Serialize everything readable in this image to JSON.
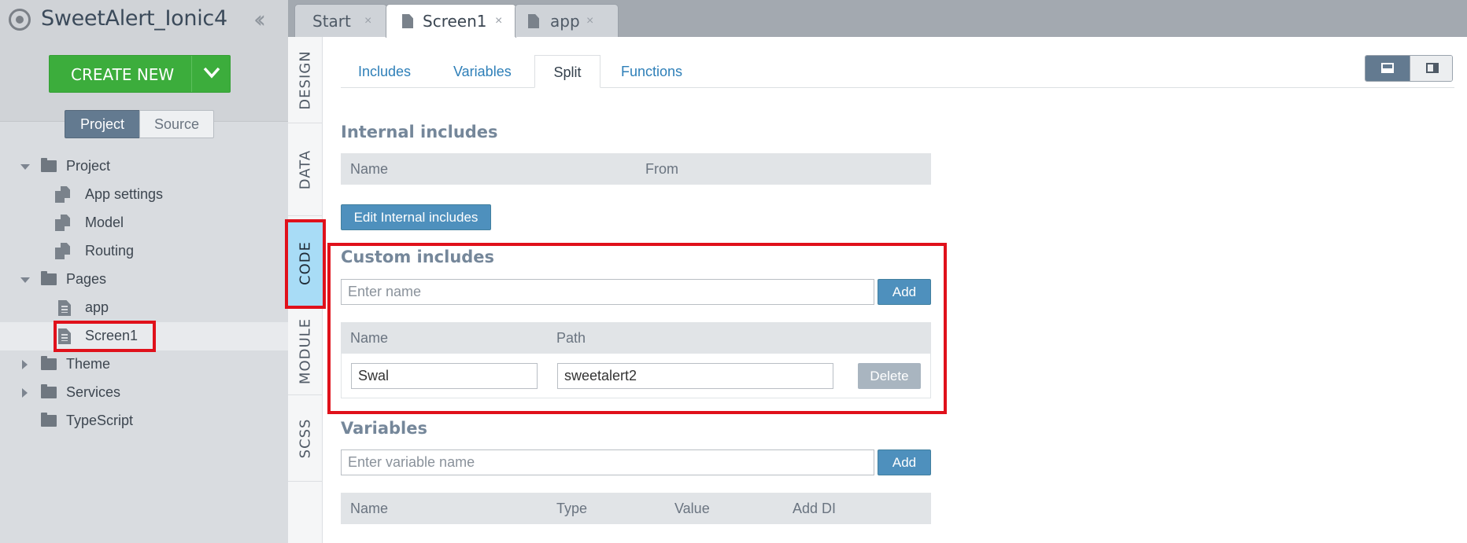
{
  "app": {
    "title": "SweetAlert_Ionic4",
    "create_label": "CREATE NEW"
  },
  "sidebar": {
    "segments": [
      {
        "label": "Project"
      },
      {
        "label": "Source"
      }
    ],
    "tree": {
      "project": "Project",
      "app_settings": "App settings",
      "model": "Model",
      "routing": "Routing",
      "pages": "Pages",
      "app": "app",
      "screen1": "Screen1",
      "theme": "Theme",
      "services": "Services",
      "typescript": "TypeScript"
    }
  },
  "tabs": [
    {
      "label": "Start",
      "close": "×"
    },
    {
      "label": "Screen1",
      "close": "×"
    },
    {
      "label": "app",
      "close": "×"
    }
  ],
  "vtabs": [
    {
      "label": "DESIGN"
    },
    {
      "label": "DATA"
    },
    {
      "label": "CODE"
    },
    {
      "label": "MODULE"
    },
    {
      "label": "SCSS"
    }
  ],
  "subtabs": [
    {
      "label": "Includes"
    },
    {
      "label": "Variables"
    },
    {
      "label": "Split"
    },
    {
      "label": "Functions"
    }
  ],
  "internal": {
    "title": "Internal includes",
    "col_name": "Name",
    "col_from": "From",
    "edit_label": "Edit Internal includes"
  },
  "custom": {
    "title": "Custom includes",
    "placeholder": "Enter name",
    "add_label": "Add",
    "col_name": "Name",
    "col_path": "Path",
    "row": {
      "name": "Swal",
      "path": "sweetalert2",
      "delete_label": "Delete"
    }
  },
  "variables": {
    "title": "Variables",
    "placeholder": "Enter variable name",
    "add_label": "Add",
    "col_name": "Name",
    "col_type": "Type",
    "col_value": "Value",
    "col_adddi": "Add DI"
  },
  "colors": {
    "accent": "#3cad3c",
    "highlight": "#e0111b",
    "link": "#2e7fb8",
    "active_vtab": "#a8dcf6"
  }
}
